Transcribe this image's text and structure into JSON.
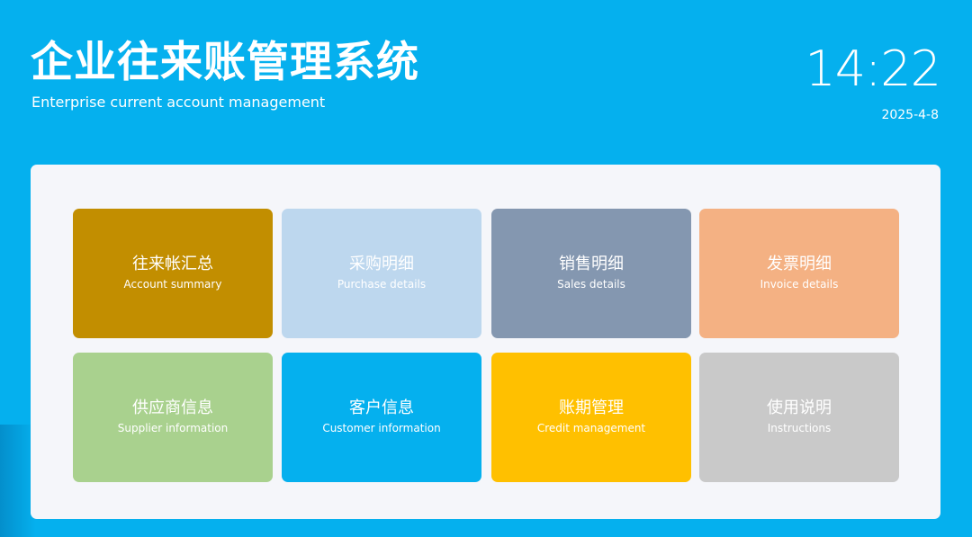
{
  "header": {
    "title": "企业往来账管理系统",
    "subtitle": "Enterprise current account management",
    "time": "14:22",
    "date": "2025-4-8"
  },
  "tiles": [
    {
      "cn": "往来帐汇总",
      "en": "Account summary",
      "color": "#c28e00"
    },
    {
      "cn": "采购明细",
      "en": "Purchase details",
      "color": "#bdd7ee"
    },
    {
      "cn": "销售明细",
      "en": "Sales details",
      "color": "#8497b0"
    },
    {
      "cn": "发票明细",
      "en": "Invoice details",
      "color": "#f4b183"
    },
    {
      "cn": "供应商信息",
      "en": "Supplier information",
      "color": "#a9d18e"
    },
    {
      "cn": "客户信息",
      "en": "Customer information",
      "color": "#05b0ee"
    },
    {
      "cn": "账期管理",
      "en": "Credit management",
      "color": "#ffc000"
    },
    {
      "cn": "使用说明",
      "en": "Instructions",
      "color": "#c9c9c9"
    }
  ],
  "colors": {
    "background": "#05b0ee",
    "panel": "#f5f6fa"
  }
}
